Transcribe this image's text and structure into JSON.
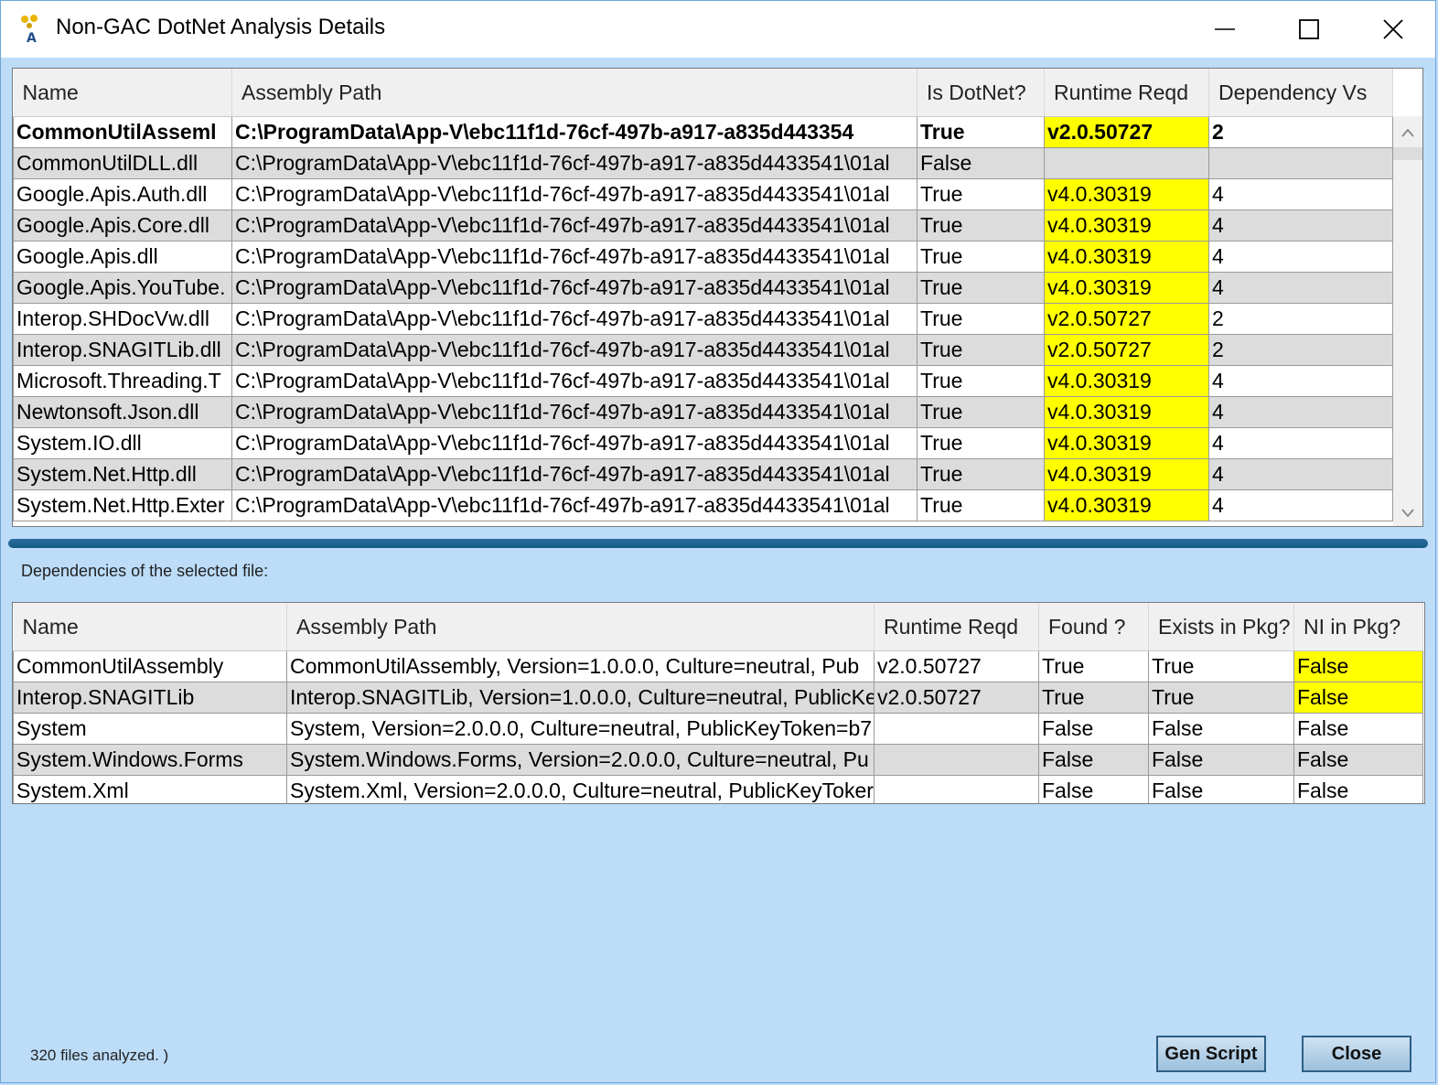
{
  "window": {
    "title": "Non-GAC DotNet Analysis Details"
  },
  "top_table": {
    "columns": [
      "Name",
      "Assembly Path",
      "Is DotNet?",
      "Runtime Reqd",
      "Dependency Vs"
    ],
    "rows": [
      {
        "name": "CommonUtilAsseml",
        "path": "C:\\ProgramData\\App-V\\ebc11f1d-76cf-497b-a917-a835d443354",
        "dotnet": "True",
        "runtime": "v2.0.50727",
        "dep": "2",
        "bold": true
      },
      {
        "name": "CommonUtilDLL.dll",
        "path": "C:\\ProgramData\\App-V\\ebc11f1d-76cf-497b-a917-a835d4433541\\01al",
        "dotnet": "False",
        "runtime": "",
        "dep": ""
      },
      {
        "name": "Google.Apis.Auth.dll",
        "path": "C:\\ProgramData\\App-V\\ebc11f1d-76cf-497b-a917-a835d4433541\\01al",
        "dotnet": "True",
        "runtime": "v4.0.30319",
        "dep": "4"
      },
      {
        "name": "Google.Apis.Core.dll",
        "path": "C:\\ProgramData\\App-V\\ebc11f1d-76cf-497b-a917-a835d4433541\\01al",
        "dotnet": "True",
        "runtime": "v4.0.30319",
        "dep": "4"
      },
      {
        "name": "Google.Apis.dll",
        "path": "C:\\ProgramData\\App-V\\ebc11f1d-76cf-497b-a917-a835d4433541\\01al",
        "dotnet": "True",
        "runtime": "v4.0.30319",
        "dep": "4"
      },
      {
        "name": "Google.Apis.YouTube.",
        "path": "C:\\ProgramData\\App-V\\ebc11f1d-76cf-497b-a917-a835d4433541\\01al",
        "dotnet": "True",
        "runtime": "v4.0.30319",
        "dep": "4"
      },
      {
        "name": "Interop.SHDocVw.dll",
        "path": "C:\\ProgramData\\App-V\\ebc11f1d-76cf-497b-a917-a835d4433541\\01al",
        "dotnet": "True",
        "runtime": "v2.0.50727",
        "dep": "2"
      },
      {
        "name": "Interop.SNAGITLib.dll",
        "path": "C:\\ProgramData\\App-V\\ebc11f1d-76cf-497b-a917-a835d4433541\\01al",
        "dotnet": "True",
        "runtime": "v2.0.50727",
        "dep": "2"
      },
      {
        "name": "Microsoft.Threading.T",
        "path": "C:\\ProgramData\\App-V\\ebc11f1d-76cf-497b-a917-a835d4433541\\01al",
        "dotnet": "True",
        "runtime": "v4.0.30319",
        "dep": "4"
      },
      {
        "name": "Newtonsoft.Json.dll",
        "path": "C:\\ProgramData\\App-V\\ebc11f1d-76cf-497b-a917-a835d4433541\\01al",
        "dotnet": "True",
        "runtime": "v4.0.30319",
        "dep": "4"
      },
      {
        "name": "System.IO.dll",
        "path": "C:\\ProgramData\\App-V\\ebc11f1d-76cf-497b-a917-a835d4433541\\01al",
        "dotnet": "True",
        "runtime": "v4.0.30319",
        "dep": "4"
      },
      {
        "name": "System.Net.Http.dll",
        "path": "C:\\ProgramData\\App-V\\ebc11f1d-76cf-497b-a917-a835d4433541\\01al",
        "dotnet": "True",
        "runtime": "v4.0.30319",
        "dep": "4"
      },
      {
        "name": "System.Net.Http.Exter",
        "path": "C:\\ProgramData\\App-V\\ebc11f1d-76cf-497b-a917-a835d4433541\\01al",
        "dotnet": "True",
        "runtime": "v4.0.30319",
        "dep": "4"
      }
    ]
  },
  "dependencies": {
    "label": "Dependencies of the selected file:",
    "columns": [
      "Name",
      "Assembly Path",
      "Runtime Reqd",
      "Found ?",
      "Exists in Pkg?",
      "NI in Pkg?"
    ],
    "rows": [
      {
        "name": "CommonUtilAssembly",
        "path": "CommonUtilAssembly, Version=1.0.0.0, Culture=neutral, Pub",
        "runtime": "v2.0.50727",
        "found": "True",
        "exists": "True",
        "ni": "False",
        "ni_hl": true
      },
      {
        "name": "Interop.SNAGITLib",
        "path": "Interop.SNAGITLib, Version=1.0.0.0, Culture=neutral, PublicKe",
        "runtime": "v2.0.50727",
        "found": "True",
        "exists": "True",
        "ni": "False",
        "ni_hl": true
      },
      {
        "name": "System",
        "path": "System, Version=2.0.0.0, Culture=neutral, PublicKeyToken=b7",
        "runtime": "",
        "found": "False",
        "exists": "False",
        "ni": "False",
        "ni_hl": false
      },
      {
        "name": "System.Windows.Forms",
        "path": "System.Windows.Forms, Version=2.0.0.0, Culture=neutral, Pu",
        "runtime": "",
        "found": "False",
        "exists": "False",
        "ni": "False",
        "ni_hl": false
      },
      {
        "name": "System.Xml",
        "path": "System.Xml, Version=2.0.0.0, Culture=neutral, PublicKeyToker",
        "runtime": "",
        "found": "False",
        "exists": "False",
        "ni": "False",
        "ni_hl": false
      }
    ]
  },
  "status": {
    "text": "320 files analyzed. )"
  },
  "buttons": {
    "gen_script": "Gen Script",
    "close": "Close"
  },
  "colors": {
    "highlight": "#ffff00",
    "background": "#bcdcf8",
    "splitter": "#1f6694"
  }
}
